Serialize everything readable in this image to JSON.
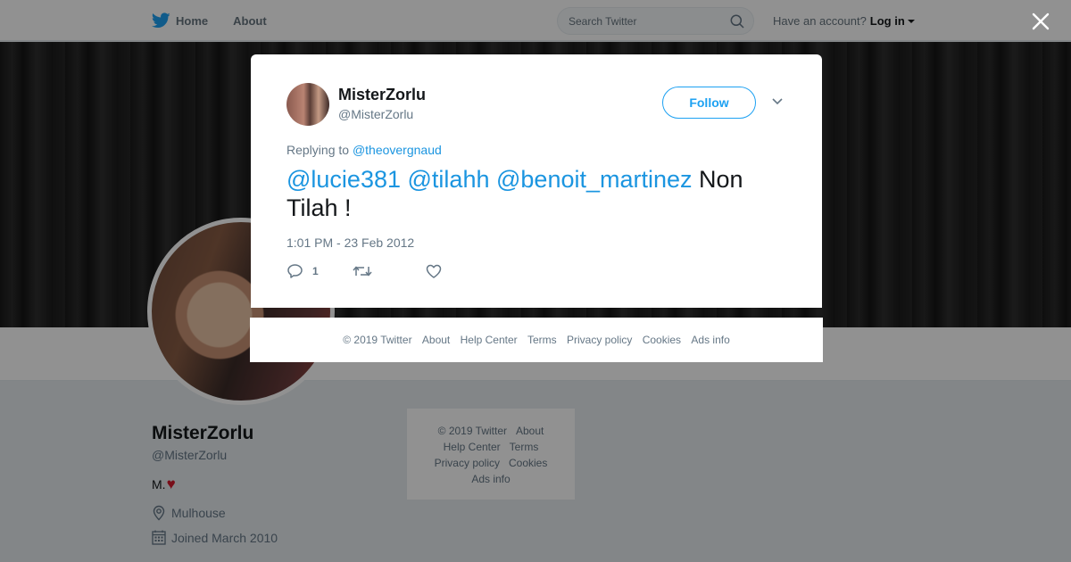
{
  "nav": {
    "home": "Home",
    "about": "About"
  },
  "search": {
    "placeholder": "Search Twitter"
  },
  "account": {
    "prompt": "Have an account?",
    "login": "Log in"
  },
  "profile": {
    "name": "MisterZorlu",
    "handle": "@MisterZorlu",
    "bio": "M.",
    "bio_emoji": "♥",
    "location": "Mulhouse",
    "joined": "Joined March 2010"
  },
  "sidebar_footer": {
    "copyright": "© 2019 Twitter",
    "about": "About",
    "help": "Help Center",
    "terms": "Terms",
    "privacy": "Privacy policy",
    "cookies": "Cookies",
    "ads": "Ads info"
  },
  "tweet": {
    "name": "MisterZorlu",
    "handle": "@MisterZorlu",
    "follow_label": "Follow",
    "replying_prefix": "Replying to",
    "replying_to": "@theovergnaud",
    "mentions": [
      "@lucie381",
      "@tilahh",
      "@benoit_martinez"
    ],
    "text": "Non Tilah !",
    "timestamp": "1:01 PM - 23 Feb 2012",
    "reply_count": "1"
  },
  "modal_footer": {
    "copyright": "© 2019 Twitter",
    "about": "About",
    "help": "Help Center",
    "terms": "Terms",
    "privacy": "Privacy policy",
    "cookies": "Cookies",
    "ads": "Ads info"
  },
  "colors": {
    "accent": "#1da1f2",
    "link": "#1b95e0",
    "heart": "#d31a2c"
  }
}
